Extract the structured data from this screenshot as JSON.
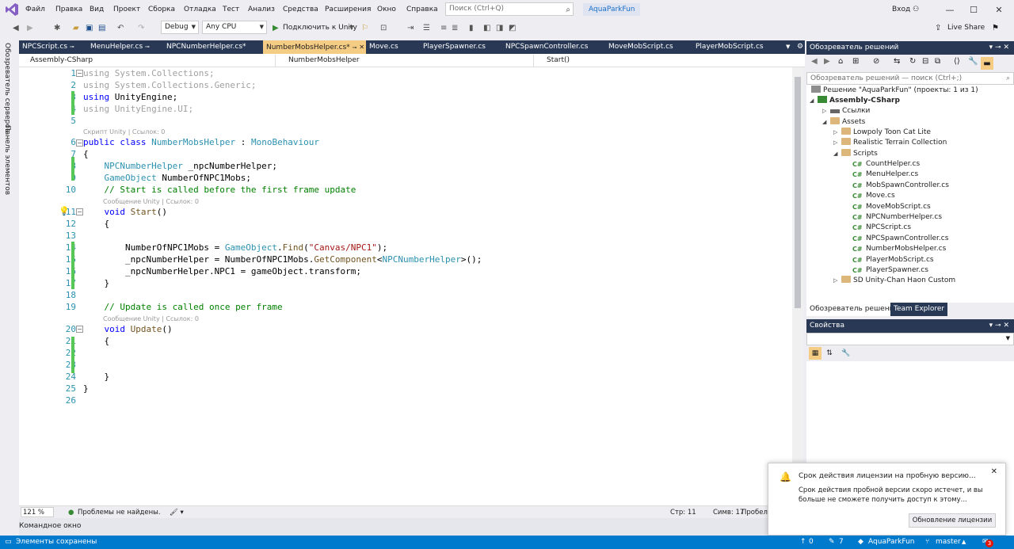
{
  "titlebar": {
    "menus": [
      "Файл",
      "Правка",
      "Вид",
      "Проект",
      "Сборка",
      "Отладка",
      "Тест",
      "Анализ",
      "Средства",
      "Расширения",
      "Окно",
      "Справка"
    ],
    "search_placeholder": "Поиск (Ctrl+Q)",
    "project_name": "AquaParkFun",
    "signin": "Вход"
  },
  "toolbar": {
    "configuration": "Debug",
    "platform": "Any CPU",
    "attach_label": "Подключить к Unity",
    "live_share": "Live Share"
  },
  "sidebar": {
    "server_explorer": "Обозреватель серверов",
    "toolbox": "Панель элементов"
  },
  "tabs": [
    {
      "label": "NPCScript.cs"
    },
    {
      "label": "MenuHelper.cs"
    },
    {
      "label": "NPCNumberHelper.cs*"
    },
    {
      "label": "NumberMobsHelper.cs*",
      "active": true
    },
    {
      "label": "Move.cs"
    },
    {
      "label": "PlayerSpawner.cs"
    },
    {
      "label": "NPCSpawnController.cs"
    },
    {
      "label": "MoveMobScript.cs"
    },
    {
      "label": "PlayerMobScript.cs"
    }
  ],
  "navbar": {
    "project": "Assembly-CSharp",
    "class": "NumberMobsHelper",
    "member": "Start()"
  },
  "codelens": {
    "class_lens": "Скрипт Unity | Ссылок: 0",
    "start_lens": "Сообщение Unity | Ссылок: 0",
    "update_lens": "Сообщение Unity | Ссылок: 0"
  },
  "code_lines": [
    "1",
    "2",
    "3",
    "4",
    "5",
    "6",
    "7",
    "8",
    "9",
    "10",
    "11",
    "12",
    "13",
    "14",
    "15",
    "16",
    "17",
    "18",
    "19",
    "20",
    "21",
    "22",
    "23",
    "24",
    "25",
    "26"
  ],
  "editor_status": {
    "zoom": "121 %",
    "problems": "Проблемы не найдены.",
    "line": "Стр: 11",
    "col": "Симв: 17",
    "spaces": "Пробелы"
  },
  "command_window": "Командное окно",
  "statusbar": {
    "message": "Элементы сохранены",
    "up": "0",
    "pencil": "7",
    "repo": "AquaParkFun",
    "branch": "master",
    "notifications": "3"
  },
  "solution_explorer": {
    "title": "Обозреватель решений",
    "search_placeholder": "Обозреватель решений — поиск (Ctrl+;)",
    "solution": "Решение \"AquaParkFun\" (проекты: 1 из 1)",
    "project": "Assembly-CSharp",
    "refs": "Ссылки",
    "assets": "Assets",
    "folders": [
      "Lowpoly Toon Cat Lite",
      "Realistic Terrain Collection",
      "Scripts"
    ],
    "scripts": [
      "CountHelper.cs",
      "MenuHelper.cs",
      "MobSpawnController.cs",
      "Move.cs",
      "MoveMobScript.cs",
      "NPCNumberHelper.cs",
      "NPCScript.cs",
      "NPCSpawnController.cs",
      "NumberMobsHelper.cs",
      "PlayerMobScript.cs",
      "PlayerSpawner.cs"
    ],
    "last_folder": "SD Unity-Chan Haon Custom",
    "tab_solution": "Обозреватель решений",
    "tab_team": "Team Explorer"
  },
  "properties": {
    "title": "Свойства"
  },
  "notification": {
    "title": "Срок действия лицензии на пробную версию...",
    "body": "Срок действия пробной версии скоро истечет, и вы больше не сможете получить доступ к этому...",
    "button": "Обновление лицензии"
  },
  "colors": {
    "accent": "#007acc",
    "tab_active": "#f5cc84",
    "panel_header": "#293955"
  }
}
